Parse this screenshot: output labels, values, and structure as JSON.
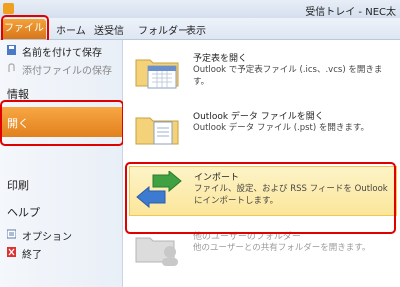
{
  "window": {
    "title": "受信トレイ - NEC太"
  },
  "ribbon": {
    "tabs": [
      "ファイル",
      "ホーム",
      "送受信",
      "フォルダー",
      "表示"
    ]
  },
  "sidebar": {
    "save_as": "名前を付けて保存",
    "save_attachments": "添付ファイルの保存",
    "info": "情報",
    "open": "開く",
    "print": "印刷",
    "help": "ヘルプ",
    "options": "オプション",
    "exit": "終了"
  },
  "actions": [
    {
      "title": "予定表を開く",
      "desc": "Outlook で予定表ファイル (.ics、.vcs) を開きます。",
      "icon": "calendar-folder-icon",
      "state": "normal"
    },
    {
      "title": "Outlook データ ファイルを開く",
      "desc": "Outlook データ ファイル (.pst) を開きます。",
      "icon": "data-file-folder-icon",
      "state": "normal"
    },
    {
      "title": "インポート",
      "desc": "ファイル、設定、および RSS フィードを Outlook にインポートします。",
      "icon": "import-arrows-icon",
      "state": "selected"
    },
    {
      "title": "他のユーザーのフォルダー",
      "desc": "他のユーザーとの共有フォルダーを開きます。",
      "icon": "shared-folder-icon",
      "state": "disabled"
    }
  ],
  "colors": {
    "accent_orange": "#e2801e",
    "highlight_red": "#e00000",
    "selected_bg": "#fbe69a"
  }
}
